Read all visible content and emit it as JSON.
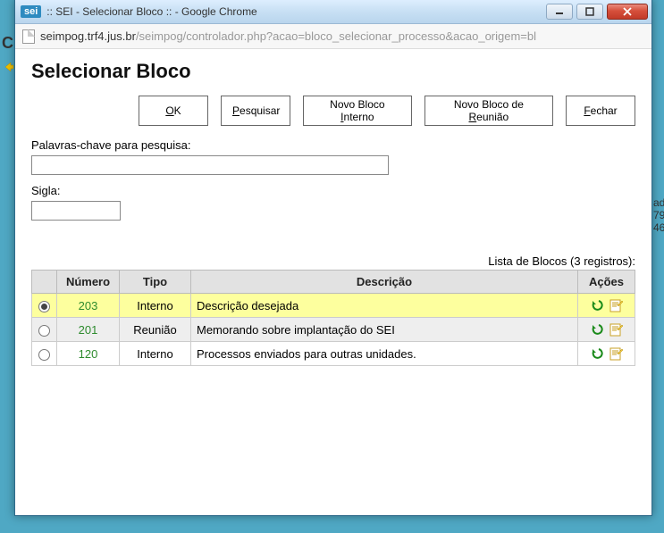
{
  "window": {
    "title": ":: SEI - Selecionar Bloco :: - Google Chrome",
    "badge": "sei"
  },
  "url": {
    "host": "seimpog.trf4.jus.br",
    "path": "/seimpog/controlador.php?acao=bloco_selecionar_processo&acao_origem=bl"
  },
  "page": {
    "title": "Selecionar Bloco",
    "keywords_label": "Palavras-chave para pesquisa:",
    "keywords_value": "",
    "sigla_label": "Sigla:",
    "sigla_value": ""
  },
  "buttons": {
    "ok": "OK",
    "pesquisar": "Pesquisar",
    "novo_interno": "Novo Bloco Interno",
    "novo_reuniao": "Novo Bloco de Reunião",
    "fechar": "Fechar"
  },
  "table": {
    "caption": "Lista de Blocos (3 registros):",
    "headers": {
      "numero": "Número",
      "tipo": "Tipo",
      "descricao": "Descrição",
      "acoes": "Ações"
    },
    "rows": [
      {
        "selected": true,
        "numero": "203",
        "tipo": "Interno",
        "descricao": "Descrição desejada"
      },
      {
        "selected": false,
        "numero": "201",
        "tipo": "Reunião",
        "descricao": "Memorando sobre implantação do SEI"
      },
      {
        "selected": false,
        "numero": "120",
        "tipo": "Interno",
        "descricao": "Processos enviados para outras unidades."
      }
    ]
  },
  "bg": {
    "letter": "C",
    "frag1": "ad",
    "frag2": "79",
    "frag3": "46"
  }
}
